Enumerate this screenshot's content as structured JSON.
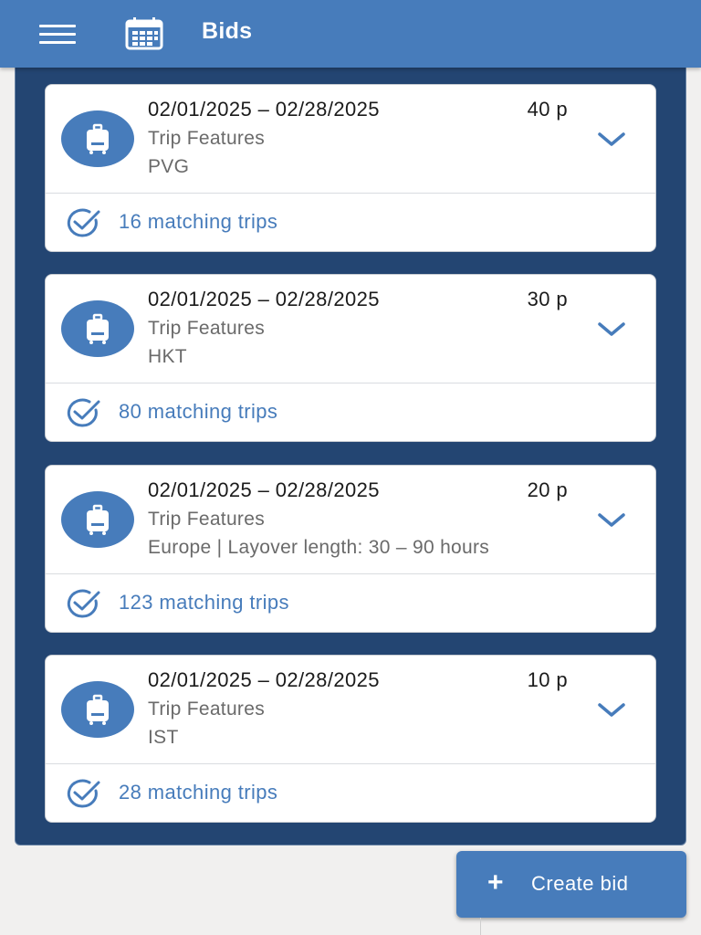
{
  "header": {
    "title": "Bids",
    "menu_icon": "hamburger-menu-icon",
    "calendar_icon": "calendar-icon",
    "bg_color": "#477cbb"
  },
  "bids": [
    {
      "date_range": "02/01/2025 – 02/28/2025",
      "points": "40 p",
      "features_label": "Trip Features",
      "detail": "PVG",
      "matching": "16 matching trips"
    },
    {
      "date_range": "02/01/2025 – 02/28/2025",
      "points": "30 p",
      "features_label": "Trip Features",
      "detail": "HKT",
      "matching": "80 matching trips"
    },
    {
      "date_range": "02/01/2025 – 02/28/2025",
      "points": "20 p",
      "features_label": "Trip Features",
      "detail": "Europe | Layover length: 30 – 90 hours",
      "matching": "123 matching trips"
    },
    {
      "date_range": "02/01/2025 – 02/28/2025",
      "points": "10 p",
      "features_label": "Trip Features",
      "detail": "IST",
      "matching": "28 matching trips"
    }
  ],
  "fab": {
    "icon": "+",
    "label": "Create bid"
  },
  "colors": {
    "accent": "#477cbb",
    "panel": "#234572",
    "text_primary": "#1b1b1b",
    "text_secondary": "#6a6a6a"
  }
}
